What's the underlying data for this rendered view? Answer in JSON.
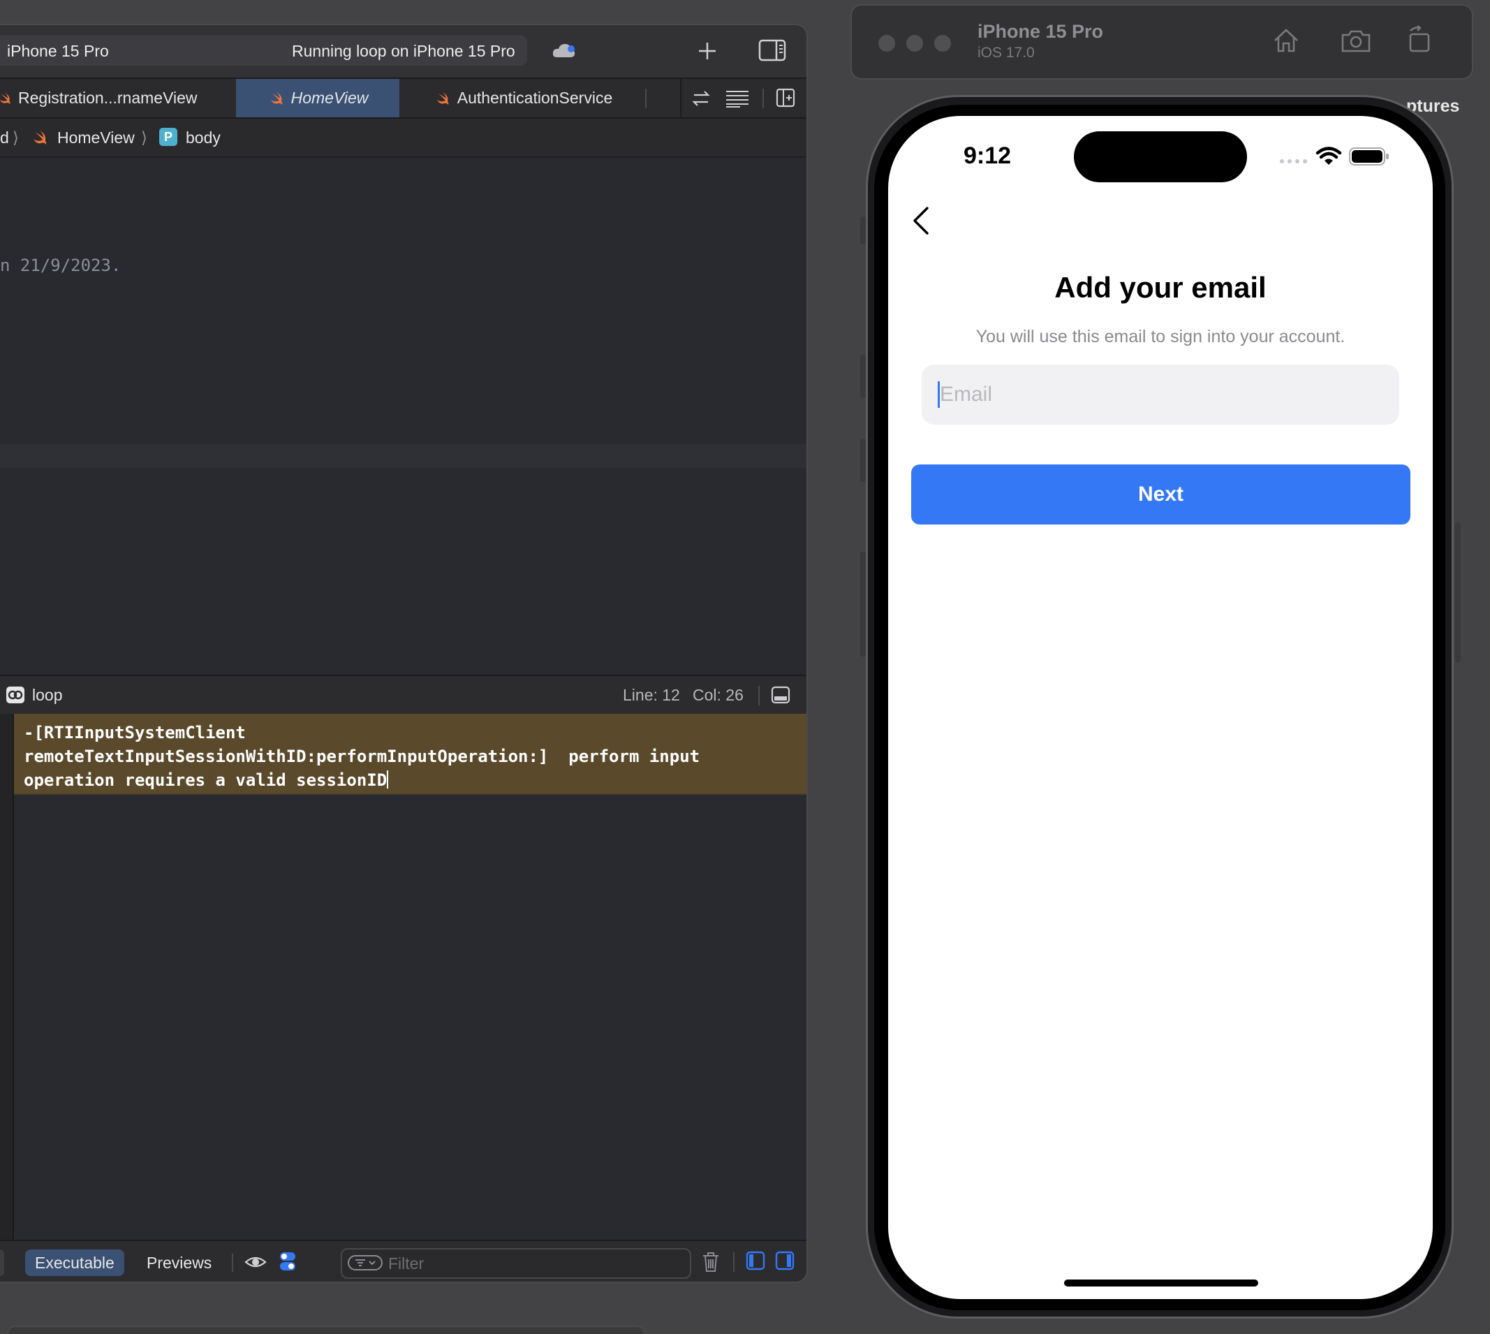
{
  "xcode": {
    "toolbar": {
      "device": "iPhone 15 Pro",
      "status": "Running loop on iPhone 15 Pro",
      "icons": [
        "cloud-icon",
        "plus-icon",
        "inspector-toggle-icon"
      ]
    },
    "tabs": [
      {
        "label": "Registration...rnameView",
        "icon": "swift-icon",
        "active": false
      },
      {
        "label": "HomeView",
        "icon": "swift-icon",
        "active": true
      },
      {
        "label": "AuthenticationService",
        "icon": "swift-icon",
        "active": false
      }
    ],
    "tab_icons": [
      "swap-icon",
      "lines-icon",
      "add-editor-icon"
    ],
    "breadcrumb": {
      "prefix": "d",
      "file": "HomeView",
      "symbol_badge": "P",
      "symbol": "body"
    },
    "editor": {
      "visible_line": "n 21/9/2023."
    },
    "debug_bar": {
      "target": "loop",
      "line": "Line: 12",
      "col": "Col: 26"
    },
    "console": {
      "message": "-[RTIInputSystemClient\nremoteTextInputSessionWithID:performInputOperation:]  perform input\noperation requires a valid sessionID"
    },
    "console_bar": {
      "executable": "Executable",
      "previews": "Previews",
      "filter_placeholder": "Filter"
    }
  },
  "simulator": {
    "title": "iPhone 15 Pro",
    "os": "iOS 17.0",
    "behind_label": "ptures",
    "icons": [
      "home-icon",
      "screenshot-icon",
      "rotate-icon"
    ],
    "status_bar": {
      "time": "9:12"
    },
    "screen": {
      "title": "Add your email",
      "subtitle": "You will use this email to sign into your account.",
      "email_placeholder": "Email",
      "next_label": "Next"
    }
  },
  "colors": {
    "accent_blue": "#3478f6",
    "active_tab": "#3a5174",
    "console_warning_bg": "#5a4a2b",
    "swift_orange": "#f2763a"
  }
}
